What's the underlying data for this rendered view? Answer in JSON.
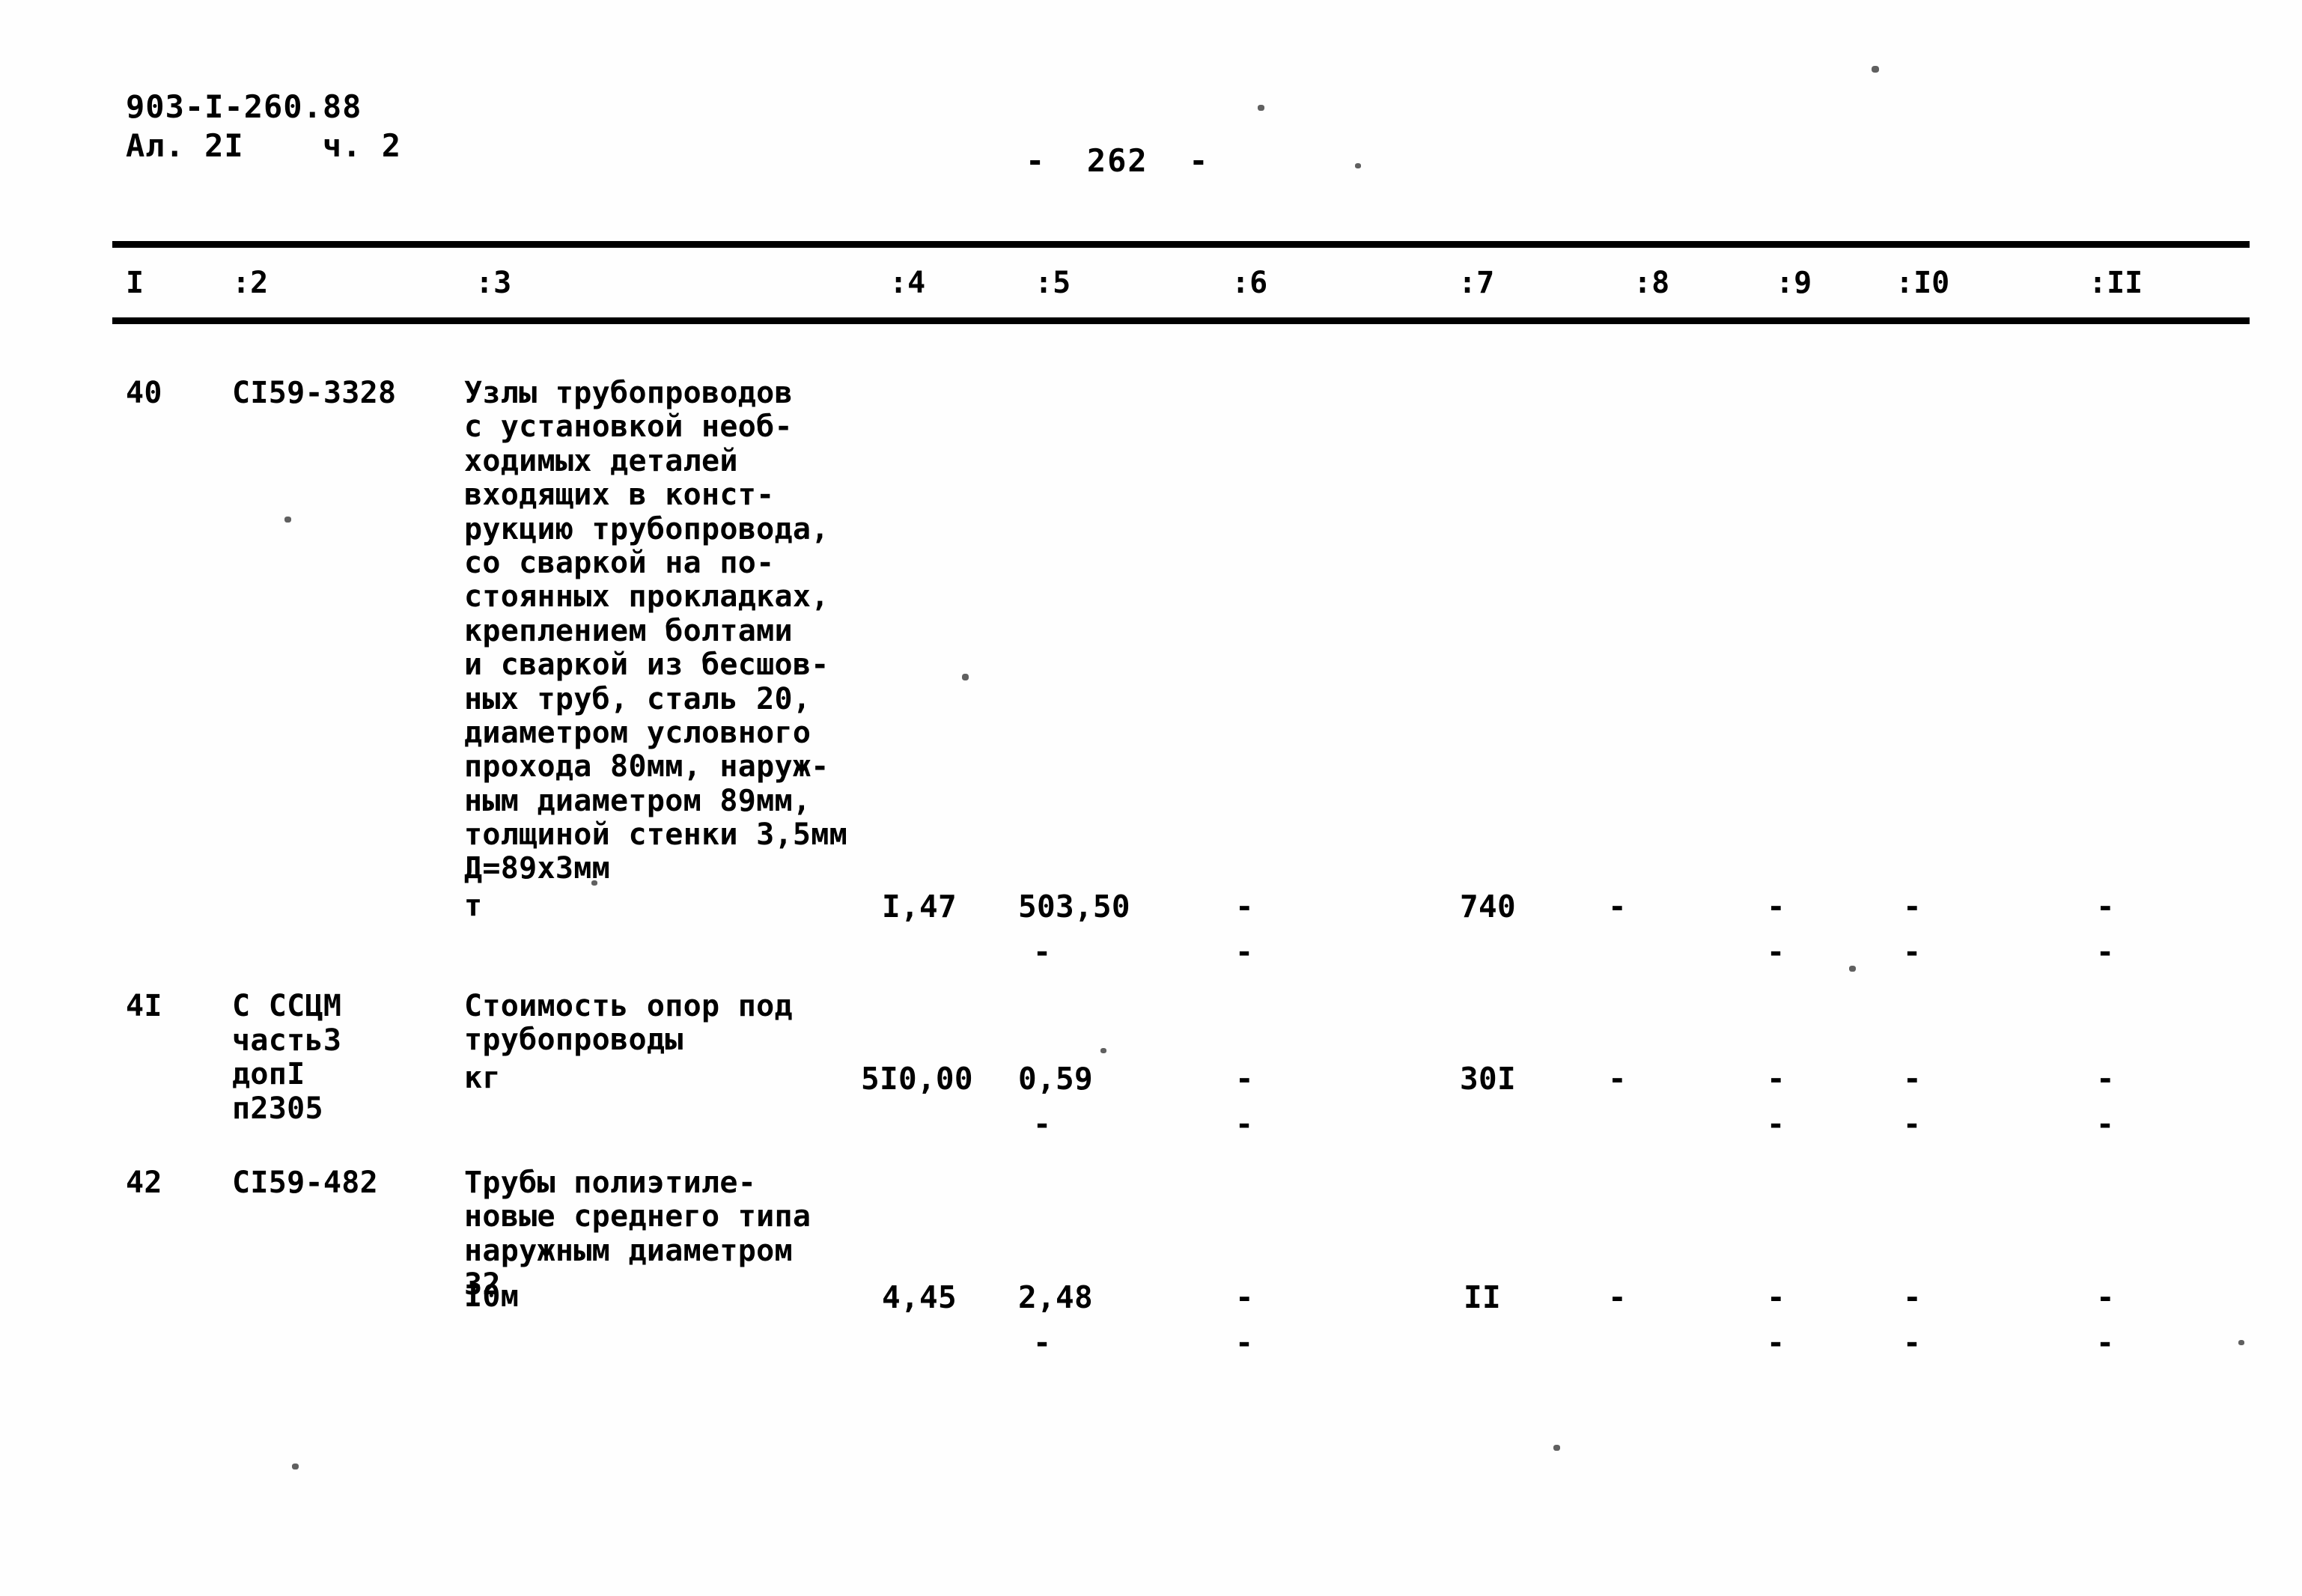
{
  "document": {
    "code_line": "903-I-260.88",
    "sheet_line": "Ал. 2I    ч. 2",
    "page_marker": "-  262  -"
  },
  "table": {
    "column_headers": [
      "I",
      ":2",
      ":3",
      ":4",
      ":5",
      ":6",
      ":7",
      ":8",
      ":9",
      ":I0",
      ":II"
    ],
    "rows": [
      {
        "number": "40",
        "code": "CI59-3328",
        "description": "Узлы трубопроводов\nс установкой необ-\nходимых деталей\nвходящих в конст-\nрукцию трубопровода,\nсо сваркой на по-\nстоянных прокладках,\nкреплением болтами\nи сваркой из бесшов-\nных труб, сталь 20,\nдиаметром условного\nпрохода 80мм, наруж-\nным диаметром 89мм,\nтолщиной стенки 3,5мм\nД=89х3мм",
        "unit": "т",
        "c4": "I,47",
        "c5": "503,50",
        "c5b": "-",
        "c6": "-",
        "c6b": "-",
        "c7": "740",
        "c8": "-",
        "c9": "-",
        "c9b": "-",
        "c10": "-",
        "c10b": "-",
        "c11": "-",
        "c11b": "-"
      },
      {
        "number": "4I",
        "code": "С ССЦМ\nчастьЗ\nдопI\nп2305",
        "description": "Стоимость опор под\nтрубопроводы",
        "unit": "кг",
        "c4": "5I0,00",
        "c5": "0,59",
        "c5b": "-",
        "c6": "-",
        "c6b": "-",
        "c7": "30I",
        "c8": "-",
        "c9": "-",
        "c9b": "-",
        "c10": "-",
        "c10b": "-",
        "c11": "-",
        "c11b": "-"
      },
      {
        "number": "42",
        "code": "CI59-482",
        "description": "Трубы полиэтиле-\nновые среднего типа\nнаружным диаметром\n32",
        "unit": "I0м",
        "c4": "4,45",
        "c5": "2,48",
        "c5b": "-",
        "c6": "-",
        "c6b": "-",
        "c7": "II",
        "c8": "-",
        "c9": "-",
        "c9b": "-",
        "c10": "-",
        "c10b": "-",
        "c11": "-",
        "c11b": "-"
      }
    ]
  },
  "colors": {
    "ink": "#000000",
    "paper": "#ffffff"
  }
}
